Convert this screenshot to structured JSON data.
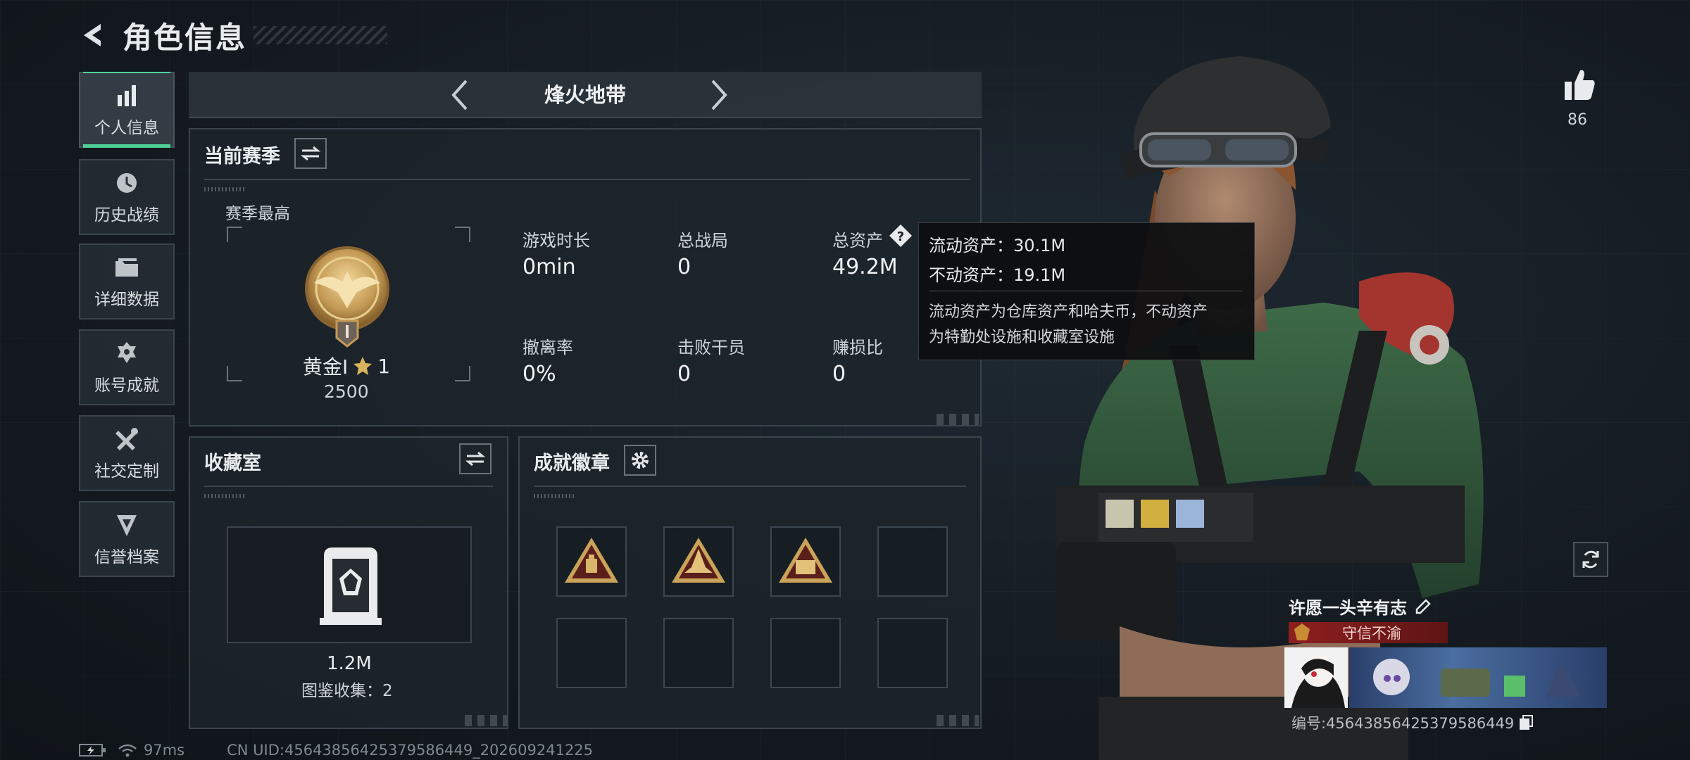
{
  "header": {
    "title": "角色信息"
  },
  "nav": [
    {
      "label": "个人信息",
      "icon": "bar-chart-icon",
      "active": true
    },
    {
      "label": "历史战绩",
      "icon": "clock-icon"
    },
    {
      "label": "详细数据",
      "icon": "folder-icon"
    },
    {
      "label": "账号成就",
      "icon": "trophy-icon"
    },
    {
      "label": "社交定制",
      "icon": "tools-icon"
    },
    {
      "label": "信誉档案",
      "icon": "shield-icon"
    }
  ],
  "mode_bar": {
    "title": "烽火地带"
  },
  "season_panel": {
    "title": "当前赛季",
    "best_label": "赛季最高",
    "rank_name": "黄金Ⅰ",
    "rank_stars": "1",
    "rank_score": "2500",
    "stats": [
      {
        "label": "游戏时长",
        "value": "0min"
      },
      {
        "label": "总战局",
        "value": "0"
      },
      {
        "label": "总资产",
        "value": "49.2M"
      },
      {
        "label": "撤离率",
        "value": "0%"
      },
      {
        "label": "击败干员",
        "value": "0"
      },
      {
        "label": "赚损比",
        "value": "0"
      }
    ]
  },
  "tooltip": {
    "line1": "流动资产：30.1M",
    "line2": "不动资产：19.1M",
    "desc1": "流动资产为仓库资产和哈夫币，不动资产",
    "desc2": "为特勤处设施和收藏室设施"
  },
  "collection_panel": {
    "title": "收藏室",
    "value": "1.2M",
    "subtitle": "图鉴收集：2"
  },
  "achievement_panel": {
    "title": "成就徽章"
  },
  "likes": {
    "count": "86"
  },
  "player": {
    "name": "许愿一头辛有志",
    "title": "守信不渝",
    "id_text": "编号:456438564253795864​49"
  },
  "status": {
    "ping": "97ms",
    "uid": "CN UID:456438564253795864​49_202609241225"
  },
  "colors": {
    "accent": "#4fd19a",
    "title_red": "#8e1f1f",
    "gold": "#c9a35a"
  }
}
